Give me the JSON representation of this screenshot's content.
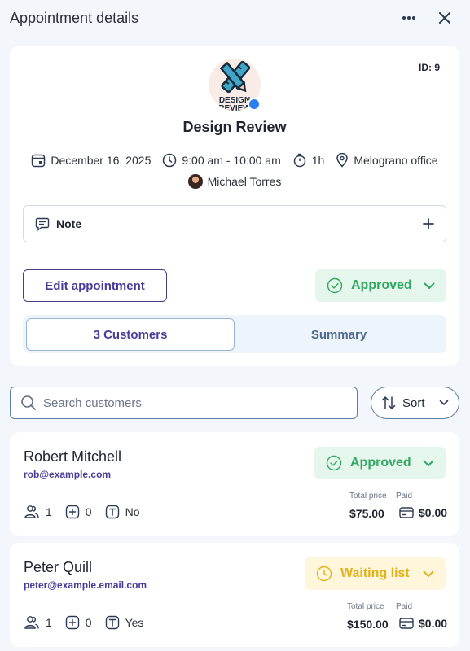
{
  "header": {
    "title": "Appointment details",
    "more_icon": "more-horizontal-icon",
    "close_icon": "close-icon"
  },
  "appointment": {
    "id_label": "ID: 9",
    "service_name": "Design Review",
    "logo_text_line1": "DESIGN",
    "logo_text_line2": "REVIEW",
    "date": "December 16, 2025",
    "time": "9:00 am - 10:00 am",
    "duration": "1h",
    "location": "Melograno office",
    "employee": "Michael Torres",
    "note_label": "Note",
    "edit_label": "Edit appointment",
    "status": "Approved",
    "tabs": [
      {
        "label": "3 Customers"
      },
      {
        "label": "Summary"
      }
    ]
  },
  "search": {
    "placeholder": "Search customers"
  },
  "sort": {
    "label": "Sort"
  },
  "customers": [
    {
      "name": "Robert Mitchell",
      "email": "rob@example.com",
      "status": "Approved",
      "persons": "1",
      "extras": "0",
      "custom_field": "No",
      "total_price_label": "Total price",
      "total_price": "$75.00",
      "paid_label": "Paid",
      "paid": "$0.00"
    },
    {
      "name": "Peter Quill",
      "email": "peter@example.email.com",
      "status": "Waiting list",
      "persons": "1",
      "extras": "0",
      "custom_field": "Yes",
      "total_price_label": "Total price",
      "total_price": "$150.00",
      "paid_label": "Paid",
      "paid": "$0.00"
    }
  ],
  "colors": {
    "accent": "#4a3b9a",
    "approved": "#2fa862",
    "approved_bg": "#e5f6ec",
    "waiting": "#e0b21a",
    "waiting_bg": "#fff6dc",
    "badge_blue": "#2a7ef0"
  }
}
